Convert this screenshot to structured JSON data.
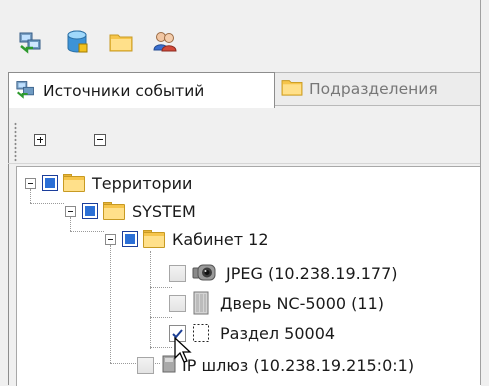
{
  "tabs": [
    {
      "label": "Источники событий",
      "icon": "event-sources-icon",
      "active": true
    },
    {
      "label": "Подразделения",
      "icon": "folder-icon",
      "active": false
    }
  ],
  "toolbar": {
    "buttons": [
      "network-icon",
      "database-icon",
      "folder-icon",
      "users-icon"
    ]
  },
  "panel_toolbar": {
    "buttons": [
      "expand-all-icon",
      "collapse-all-icon"
    ]
  },
  "tree": {
    "items": [
      {
        "label": "Территории",
        "level": 0
      },
      {
        "label": "SYSTEM",
        "level": 1
      },
      {
        "label": "Кабинет 12",
        "level": 2
      },
      {
        "label": "JPEG (10.238.19.177)",
        "level": 3,
        "icon": "camera-icon",
        "checked": false
      },
      {
        "label": "Дверь NC-5000 (11)",
        "level": 3,
        "icon": "door-icon",
        "checked": false
      },
      {
        "label": "Раздел 50004",
        "level": 3,
        "icon": "section-icon",
        "checked": true
      },
      {
        "label": "IP шлюз (10.238.19.215:0:1)",
        "level": 2,
        "icon": "gateway-icon",
        "checked": false
      }
    ]
  },
  "colors": {
    "folder": "#f6c54b",
    "tri_state": "#2b6fd6",
    "selection_border": "#8d8d8d"
  }
}
